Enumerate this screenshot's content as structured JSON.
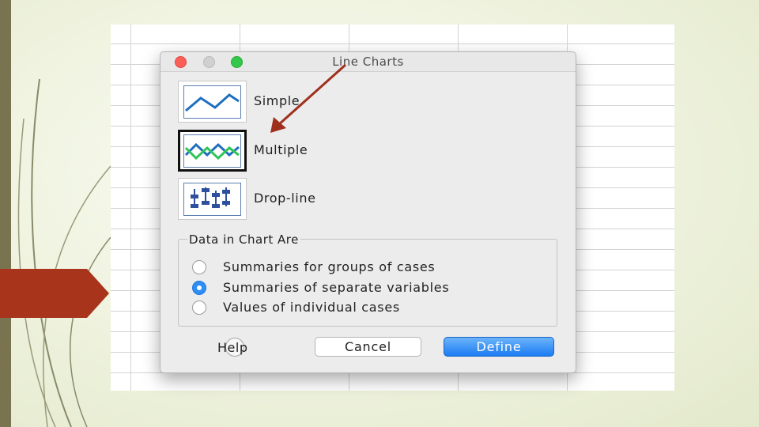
{
  "dialog": {
    "title": "Line Charts",
    "chart_types": [
      {
        "label": "Simple",
        "icon": "simple-line-chart-icon",
        "selected": false
      },
      {
        "label": "Multiple",
        "icon": "multiple-line-chart-icon",
        "selected": true
      },
      {
        "label": "Drop-line",
        "icon": "drop-line-chart-icon",
        "selected": false
      }
    ],
    "data_group": {
      "label": "Data in Chart Are",
      "options": [
        {
          "label": "Summaries for groups of cases",
          "checked": false
        },
        {
          "label": "Summaries of separate variables",
          "checked": true
        },
        {
          "label": "Values of individual cases",
          "checked": false
        }
      ]
    },
    "buttons": {
      "help": "Help",
      "cancel": "Cancel",
      "define": "Define"
    }
  },
  "colors": {
    "accent": "#1b7cf2",
    "annotation_arrow": "#a0301e",
    "line_blue": "#1f6fbf",
    "line_green": "#2ec45a"
  }
}
